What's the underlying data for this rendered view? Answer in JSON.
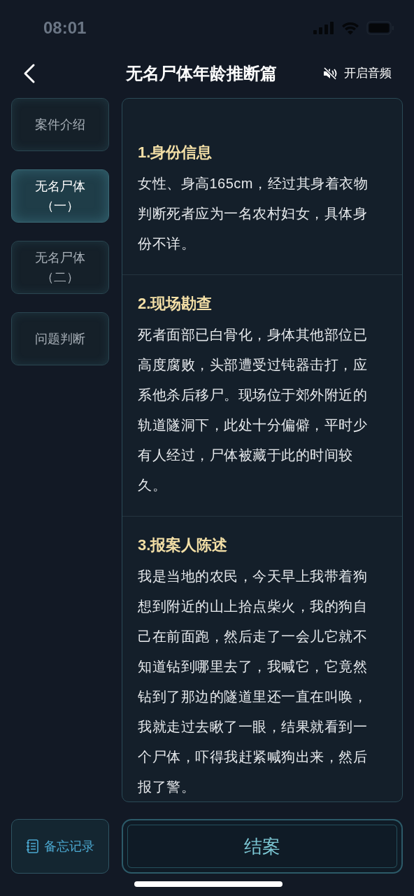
{
  "status_bar": {
    "time": "08:01"
  },
  "header": {
    "title": "无名尸体年龄推断篇",
    "audio_label": "开启音频"
  },
  "sidebar": {
    "items": [
      {
        "label": "案件介绍",
        "selected": false
      },
      {
        "label": "无名尸体（一）",
        "selected": true
      },
      {
        "label": "无名尸体（二）",
        "selected": false
      },
      {
        "label": "问题判断",
        "selected": false
      }
    ]
  },
  "sections": [
    {
      "heading": "1.身份信息",
      "body": "女性、身高165cm，经过其身着衣物判断死者应为一名农村妇女，具体身份不详。"
    },
    {
      "heading": "2.现场勘查",
      "body": "死者面部已白骨化，身体其他部位已高度腐败，头部遭受过钝器击打，应系他杀后移尸。现场位于郊外附近的轨道隧洞下，此处十分偏僻，平时少有人经过，尸体被藏于此的时间较久。"
    },
    {
      "heading": "3.报案人陈述",
      "body": "我是当地的农民，今天早上我带着狗想到附近的山上拾点柴火，我的狗自己在前面跑，然后走了一会儿它就不知道钻到哪里去了，我喊它，它竟然钻到了那边的隧道里还一直在叫唤，我就走过去瞅了一眼，结果就看到一个尸体，吓得我赶紧喊狗出来，然后报了警。"
    }
  ],
  "footer": {
    "memo_label": "备忘记录",
    "close_case_label": "结案"
  }
}
